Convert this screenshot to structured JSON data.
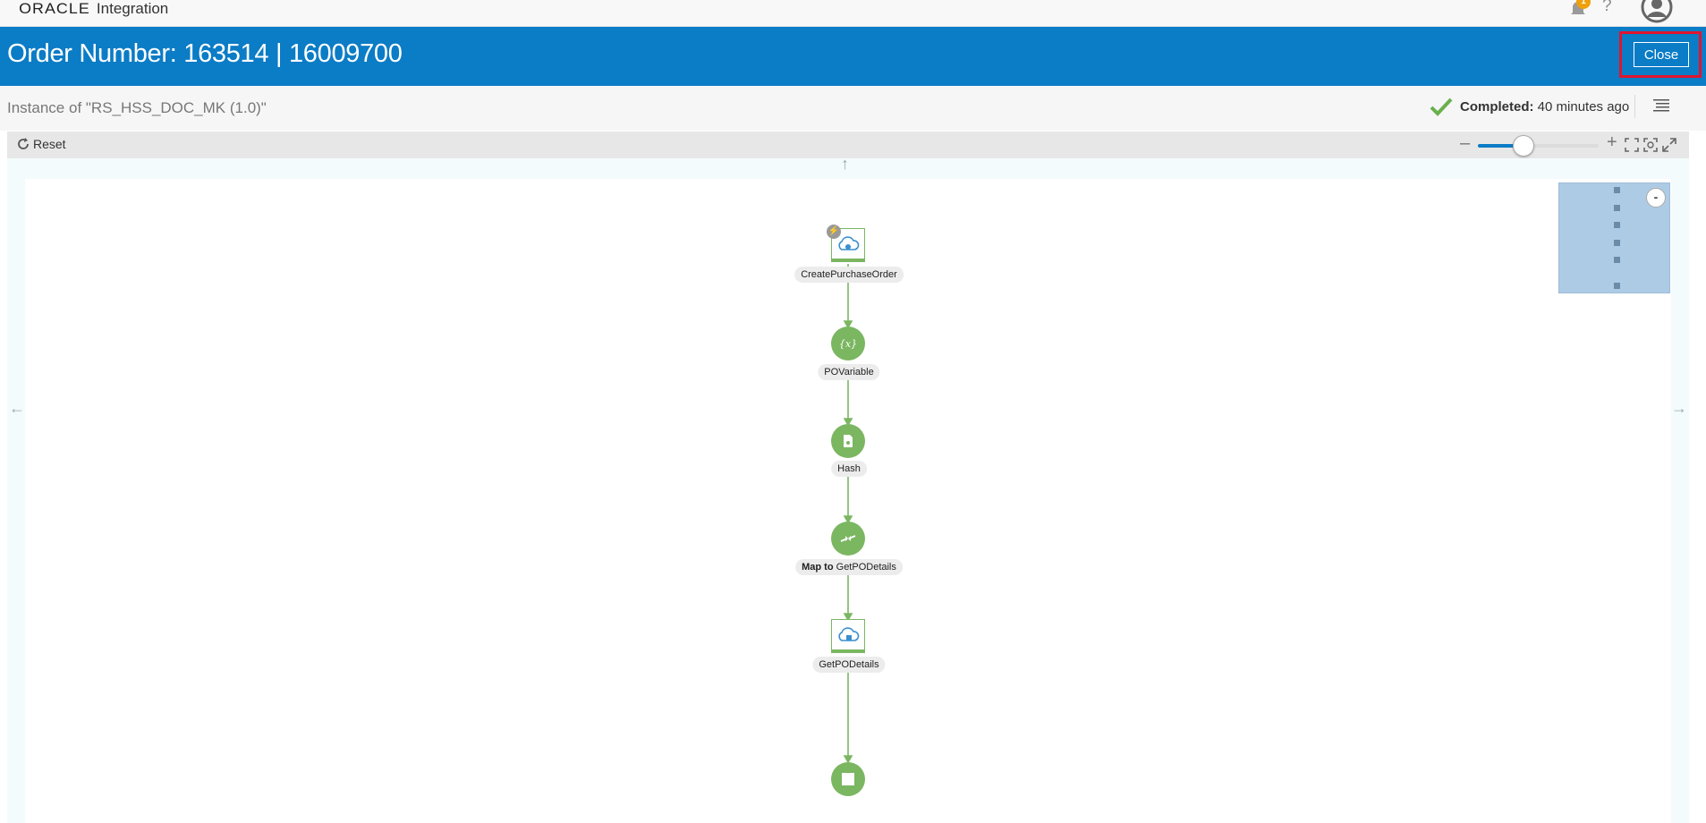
{
  "app": {
    "logo_text": "ORACLE",
    "product": "Integration",
    "notification_count": "1",
    "help_symbol": "?"
  },
  "header": {
    "title": "Order Number: 163514 | 16009700",
    "close_label": "Close"
  },
  "subheader": {
    "instance_text": "Instance of \"RS_HSS_DOC_MK (1.0)\"",
    "status_label": "Completed:",
    "status_time": "40 minutes ago"
  },
  "toolbar": {
    "reset_label": "Reset",
    "zoom_minus": "–",
    "zoom_plus": "+",
    "zoom_level_fraction": 0.38
  },
  "flow": {
    "nodes": [
      {
        "id": "create",
        "kind": "trigger",
        "label": "CreatePurchaseOrder",
        "icon": "cloud-icon"
      },
      {
        "id": "povar",
        "kind": "assign",
        "label": "POVariable",
        "icon": "variable-icon"
      },
      {
        "id": "hash",
        "kind": "function",
        "label": "Hash",
        "icon": "document-icon"
      },
      {
        "id": "map",
        "kind": "map",
        "label_prefix": "Map to",
        "label": "GetPODetails",
        "icon": "map-icon"
      },
      {
        "id": "getpo",
        "kind": "invoke",
        "label": "GetPODetails",
        "icon": "cloud-icon"
      },
      {
        "id": "end",
        "kind": "stop",
        "label": "",
        "icon": "stop-icon"
      }
    ]
  },
  "minimap": {
    "toggle_symbol": "-"
  },
  "colors": {
    "header_blue": "#0b7cc6",
    "node_green": "#7bb661",
    "highlight_red": "#e0152f",
    "status_green": "#6ab04c"
  }
}
